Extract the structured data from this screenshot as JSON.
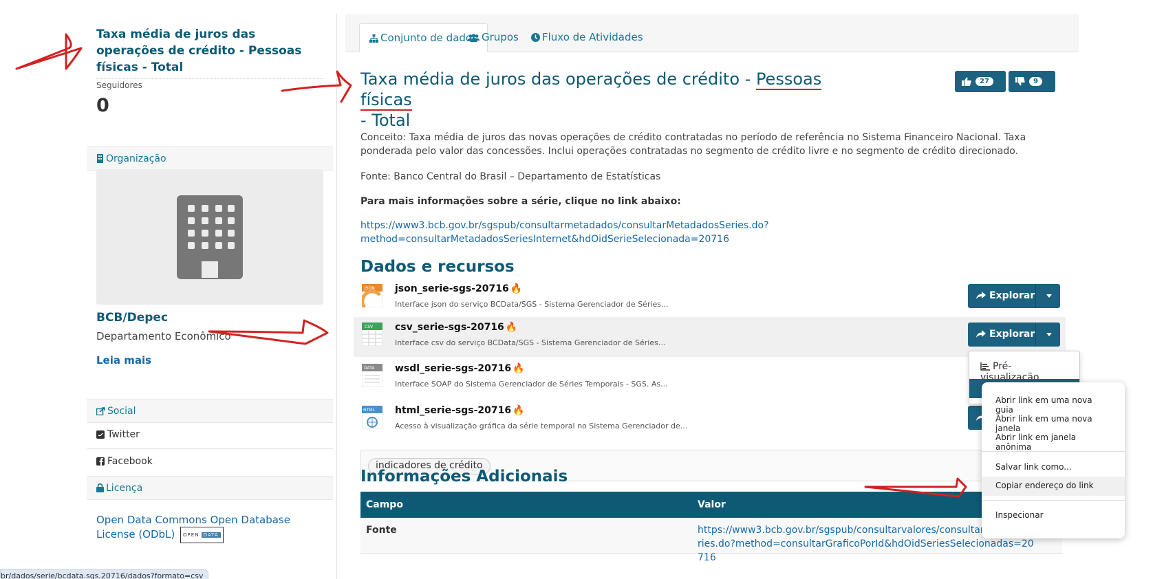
{
  "sidebar": {
    "title": "Taxa média de juros das operações de crédito - Pessoas físicas - Total",
    "followers_label": "Seguidores",
    "followers_count": "0",
    "organization_heading": "Organização",
    "org_name": "BCB/Depec",
    "org_description": "Departamento Econômico",
    "read_more": "Leia mais",
    "social_heading": "Social",
    "twitter": "Twitter",
    "facebook": "Facebook",
    "license_heading": "Licença",
    "license_text": "Open Data Commons Open Database License (ODbL)",
    "license_badge_left": "OPEN",
    "license_badge_right": "DATA"
  },
  "tabs": [
    {
      "label": "Conjunto de dados",
      "icon": "sitemap-icon",
      "active": true
    },
    {
      "label": "Grupos",
      "icon": "users-icon",
      "active": false
    },
    {
      "label": "Fluxo de Atividades",
      "icon": "clock-icon",
      "active": false
    }
  ],
  "dataset": {
    "title_part1": "Taxa média de juros das operações de crédito - ",
    "title_underlined": "Pessoas físicas",
    "title_part2": "- Total",
    "likes": "27",
    "dislikes": "9",
    "concept": "Conceito: Taxa média de juros das novas operações de crédito contratadas no período de referência no Sistema Financeiro Nacional. Taxa ponderada pelo valor das concessões. Inclui operações contratadas no segmento de crédito livre e no segmento de crédito direcionado.",
    "source": "Fonte: Banco Central do Brasil – Departamento de Estatísticas",
    "more_info": "Para mais informações sobre a série, clique no link abaixo:",
    "link_line1": "https://www3.bcb.gov.br/sgspub/consultarmetadados/consultarMetadadosSeries.do?",
    "link_line2": "method=consultarMetadadosSeriesInternet&hdOidSerieSelecionada=20716"
  },
  "resources": {
    "heading": "Dados e recursos",
    "explore_label": "Explorar",
    "items": [
      {
        "name": "json_serie-sgs-20716",
        "format": "JSON",
        "color": "#e8892b",
        "description": "Interface json do serviço BCData/SGS - Sistema Gerenciador de Séries..."
      },
      {
        "name": "csv_serie-sgs-20716",
        "format": "CSV",
        "color": "#3aa55a",
        "description": "Interface csv do serviço BCData/SGS - Sistema Gerenciador de Séries..."
      },
      {
        "name": "wsdl_serie-sgs-20716",
        "format": "DATA",
        "color": "#8a8a8a",
        "description": "Interface SOAP do Sistema Gerenciador de Séries Temporais - SGS. As..."
      },
      {
        "name": "html_serie-sgs-20716",
        "format": "HTML",
        "color": "#4a90c8",
        "description": "Acesso à visualização gráfica da série temporal no Sistema Gerenciador de..."
      }
    ],
    "flame": "🔥",
    "dropdown_preview": "Pré-visualização"
  },
  "tags": [
    "indicadores de crédito"
  ],
  "additional_info": {
    "heading": "Informações Adicionais",
    "col_field": "Campo",
    "col_value": "Valor",
    "rows": [
      {
        "field": "Fonte",
        "value": "https://www3.bcb.gov.br/sgspub/consultarvalores/consultarValoresSeries.do?method=consultarGraficoPorId&hdOidSeriesSelecionadas=20716"
      }
    ]
  },
  "context_menu": {
    "items": [
      "Abrir link em uma nova guia",
      "Abrir link em uma nova janela",
      "Abrir link em janela anônima",
      "Salvar link como...",
      "Copiar endereço do link",
      "Inspecionar"
    ]
  },
  "status_bar": "br/dados/serie/bcdata.sgs.20716/dados?formato=csv",
  "colors": {
    "primary": "#1c6280",
    "title": "#0e5a74",
    "annotation": "#d32121"
  }
}
